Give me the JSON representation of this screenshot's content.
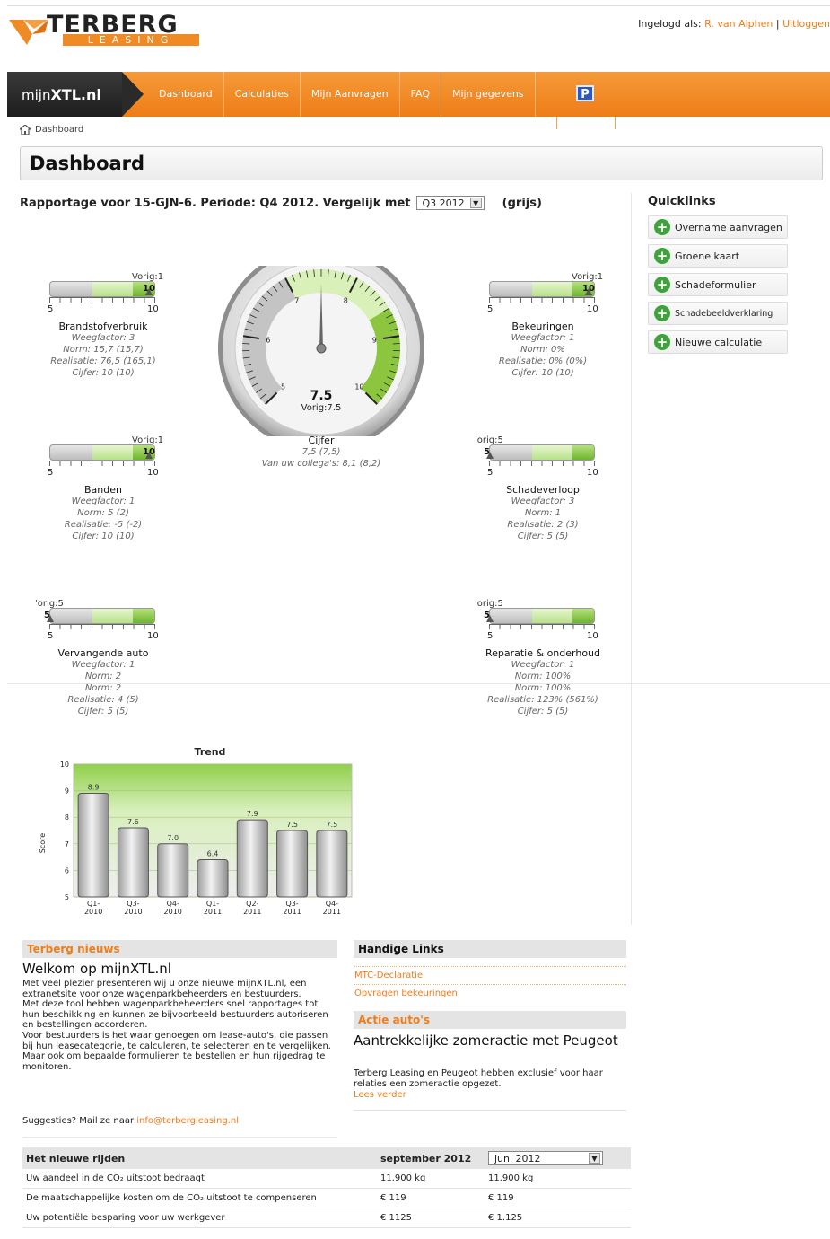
{
  "header": {
    "logo_text": "TERBERG",
    "logo_sub": "LEASING",
    "login_prefix": "Ingelogd als:",
    "user": "R. van Alphen",
    "separator": "|",
    "logout": "Uitloggen"
  },
  "nav": {
    "brand_prefix": "mijn",
    "brand_bold": "XTL",
    "brand_suffix": ".nl",
    "items": [
      "Dashboard",
      "Calculaties",
      "Mijn Aanvragen",
      "FAQ",
      "Mijn gegevens"
    ],
    "p_label": "P"
  },
  "breadcrumb": "Dashboard",
  "page_title": "Dashboard",
  "report": {
    "text": "Rapportage voor 15-GJN-6. Periode: Q4 2012. Vergelijk met",
    "compare_value": "Q3 2012",
    "suffix": "(grijs)"
  },
  "quicklinks": {
    "title": "Quicklinks",
    "items": [
      "Overname aanvragen",
      "Groene kaart",
      "Schadeformulier",
      "Schadebeeldverklaring",
      "Nieuwe calculatie"
    ]
  },
  "gauges": [
    {
      "vorig": "Vorig:1",
      "value": "10",
      "min": "5",
      "max": "10",
      "name": "Brandstofverbruik",
      "lines": [
        "Weegfactor: 3",
        "Norm: 15,7 (15,7)",
        "Realisatie: 76,5 (165,1)",
        "Cijfer: 10 (10)"
      ]
    },
    {
      "vorig": "Vorig:1",
      "value": "10",
      "min": "5",
      "max": "10",
      "name": "Bekeuringen",
      "lines": [
        "Weegfactor: 1",
        "Norm: 0%",
        "Realisatie: 0% (0%)",
        "Cijfer: 10 (10)"
      ]
    },
    {
      "vorig": "Vorig:1",
      "value": "10",
      "min": "5",
      "max": "10",
      "name": "Banden",
      "lines": [
        "Weegfactor: 1",
        "Norm: 5 (2)",
        "Realisatie: -5 (-2)",
        "Cijfer: 10 (10)"
      ]
    },
    {
      "vorig": "'orig:5",
      "value": "5",
      "min": "5",
      "max": "10",
      "name": "Schadeverloop",
      "lines": [
        "Weegfactor: 3",
        "Norm: 1",
        "Realisatie: 2 (3)",
        "Cijfer: 5 (5)"
      ]
    },
    {
      "vorig": "'orig:5",
      "value": "5",
      "min": "5",
      "max": "10",
      "name": "Vervangende auto",
      "lines": [
        "Weegfactor: 1",
        "Norm: 2",
        "Norm: 2",
        "Realisatie: 4 (5)",
        "Cijfer: 5 (5)"
      ]
    },
    {
      "vorig": "'orig:5",
      "value": "5",
      "min": "5",
      "max": "10",
      "name": "Reparatie & onderhoud",
      "lines": [
        "Weegfactor: 1",
        "Norm: 100%",
        "Norm: 100%",
        "Realisatie: 123% (561%)",
        "Cijfer: 5 (5)"
      ]
    }
  ],
  "main_gauge": {
    "value": "7.5",
    "vorig": "Vorig:7.5",
    "ticks": [
      "5",
      "6",
      "7",
      "8",
      "9",
      "10"
    ],
    "name": "Cijfer",
    "line1": "7,5 (7,5)",
    "line2": "Van uw collega's: 8,1 (8,2)",
    "needle_value": 7.5
  },
  "chart_data": {
    "type": "bar",
    "title": "Trend",
    "ylabel": "Score",
    "xlabel": "",
    "ylim": [
      5,
      10
    ],
    "yticks": [
      5,
      6,
      7,
      8,
      9,
      10
    ],
    "categories": [
      "Q1-2010",
      "Q3-2010",
      "Q4-2010",
      "Q1-2011",
      "Q2-2011",
      "Q3-2011",
      "Q4-2011"
    ],
    "values": [
      8.9,
      7.6,
      7.0,
      6.4,
      7.9,
      7.5,
      7.5
    ],
    "labels": [
      "8.9",
      "7.6",
      "7.0",
      "6.4",
      "7.9",
      "7.5",
      "7.5"
    ]
  },
  "news": {
    "header": "Terberg nieuws",
    "title": "Welkom op mijnXTL.nl",
    "paragraphs": [
      "Met veel plezier presenteren wij u onze nieuwe mijnXTL.nl, een extranetsite voor onze wagenparkbeheerders en bestuurders.",
      "Met deze tool hebben wagenparkbeheerders snel rapportages tot hun beschikking en kunnen ze bijvoorbeeld bestuurders autoriseren en bestellingen accorderen.",
      "Voor bestuurders is het waar genoegen om lease-auto's, die passen bij hun leasecategorie, te calculeren, te selecteren en te vergelijken. Maar ook om bepaalde formulieren te bestellen en hun rijgedrag te monitoren."
    ],
    "suggest_prefix": "Suggesties? Mail ze naar",
    "email": "info@terbergleasing.nl"
  },
  "links": {
    "header": "Handige Links",
    "items": [
      "MTC-Declaratie",
      "Opvragen bekeuringen"
    ]
  },
  "actie": {
    "header": "Actie auto's",
    "title": "Aantrekkelijke zomeractie met Peugeot",
    "body": "Terberg Leasing en Peugeot hebben exclusief voor haar relaties een zomeractie opgezet.",
    "more": "Lees verder"
  },
  "table": {
    "header": "Het nieuwe rijden",
    "col1": "september 2012",
    "col2_select": "juni 2012",
    "rows": [
      {
        "label": "Uw aandeel in de CO₂ uitstoot bedraagt",
        "v1": "11.900 kg",
        "v2": "11.900 kg"
      },
      {
        "label": "De maatschappelijke kosten om de CO₂ uitstoot te compenseren",
        "v1": "€ 119",
        "v2": "€ 119"
      },
      {
        "label": "Uw potentiële besparing voor uw werkgever",
        "v1": "€ 1125",
        "v2": "€ 1.125"
      }
    ]
  },
  "colors": {
    "orange": "#ef7d1a",
    "green": "#8cc63f",
    "dark": "#222222"
  }
}
